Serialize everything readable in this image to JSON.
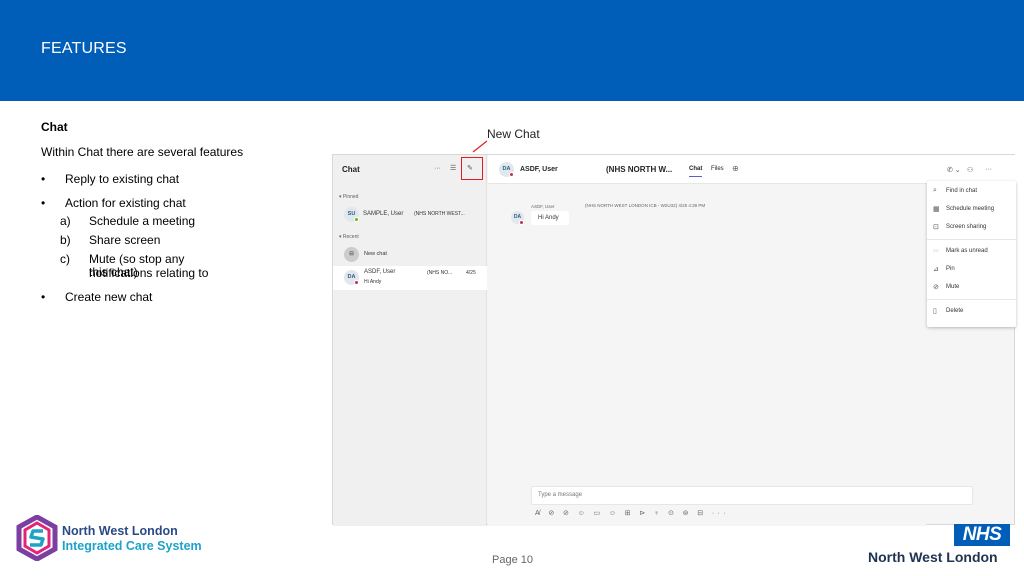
{
  "header": {
    "title": "FEATURES",
    "color": "#005eb8"
  },
  "content": {
    "heading": "Chat",
    "intro": "Within Chat there are several features",
    "bullets": [
      {
        "bullet": "•",
        "text": "Reply to existing chat"
      },
      {
        "bullet": "•",
        "text": "Action for existing chat"
      }
    ],
    "sub_items": [
      {
        "marker": "a)",
        "text": "Schedule a meeting"
      },
      {
        "marker": "b)",
        "text": "Share screen"
      },
      {
        "marker": "c)",
        "text": "Mute (so stop any notifications relating to",
        "text2": "this chat)"
      }
    ],
    "last_bullet": {
      "bullet": "•",
      "text": "Create new chat"
    }
  },
  "callout": {
    "label": "New Chat",
    "color": "#e02020"
  },
  "teams": {
    "left_panel": {
      "title": "Chat",
      "more_icon": "more-icon",
      "filter_icon": "filter-icon",
      "compose_icon": "compose-icon",
      "pinned_label": "▾ Pinned",
      "recent_label": "▾ Recent",
      "pinned": [
        {
          "initials": "SU",
          "name": "SAMPLE, User",
          "org": "(NHS NORTH WEST..."
        }
      ],
      "new_chat": "New chat",
      "recent": [
        {
          "initials": "DA",
          "name": "ASDF, User",
          "org": "(NHS NO...",
          "date": "4/25",
          "preview": "Hi Andy"
        }
      ]
    },
    "top_bar": {
      "avatar": "DA",
      "name": "ASDF, User",
      "org": "(NHS NORTH W...",
      "tab_chat": "Chat",
      "tab_files": "Files",
      "add_tab": "⊕",
      "call_icon": "✆ ⌄",
      "person_icon": "⚇",
      "more_icon": "···"
    },
    "message": {
      "sender": "ASDF, User",
      "meta": "(NHS NORTH WEST LONDON ICB - W2U32)   4/25 4:39 PM",
      "avatar": "DA",
      "text": "Hi Andy"
    },
    "composer": {
      "placeholder": "Type a message",
      "tools": "A̸ ⊘ ⊘ ☺ ▭ ☺ ⊞ ⊳ ♀ ⊙ ⊚ ⊟ ··· "
    },
    "context_menu": [
      {
        "icon": "⌕",
        "label": "Find in chat"
      },
      {
        "icon": "▦",
        "label": "Schedule meeting"
      },
      {
        "icon": "⊡",
        "label": "Screen sharing"
      },
      {
        "icon": "◌◌",
        "label": "Mark as unread"
      },
      {
        "icon": "⊿",
        "label": "Pin"
      },
      {
        "icon": "⊘",
        "label": "Mute"
      },
      {
        "icon": "▯",
        "label": "Delete"
      }
    ]
  },
  "footer": {
    "page": "Page 10",
    "left_logo_line1": "North West London",
    "left_logo_line2": "Integrated Care System",
    "nhs": "NHS",
    "right_logo": "North West London"
  }
}
